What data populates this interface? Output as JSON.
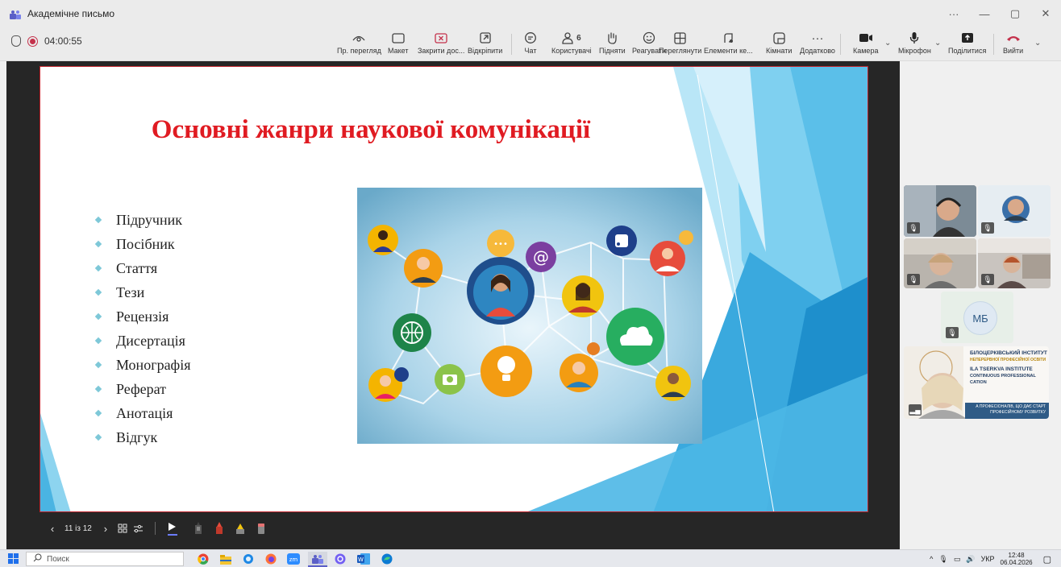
{
  "window": {
    "title": "Академічне письмо",
    "controls": [
      "···",
      "—",
      "▢",
      "✕"
    ]
  },
  "meeting": {
    "timer": "04:00:55",
    "participants_count": "6",
    "toolbar": {
      "preview": "Пр. перегляд",
      "layout": "Макет",
      "close_share": "Закрити дос...",
      "pop_out": "Відкріпити",
      "chat": "Чат",
      "people": "Користувачі",
      "raise": "Підняти",
      "react": "Реагувати",
      "view": "Переглянути",
      "elements": "Елементи ке...",
      "rooms": "Кімнати",
      "more": "Додатково",
      "camera": "Камера",
      "mic": "Мікрофон",
      "share": "Поділитися",
      "leave": "Вийти"
    }
  },
  "slide": {
    "title": "Основні жанри наукової комунікації",
    "bullets": [
      "Підручник",
      "Посібник",
      "Стаття",
      "Тези",
      "Рецензія",
      "Дисертація",
      "Монографія",
      "Реферат",
      "Анотація",
      "Відгук"
    ],
    "image_icon": "social-network-illustration"
  },
  "presenter": {
    "page": "11 із 12"
  },
  "participants": {
    "initials": "МБ",
    "institute_banner": {
      "line1": "БІЛОЦЕРКІВСЬКИЙ ІНСТИТУТ",
      "line2": "НЕПЕРЕРВНОЇ ПРОФЕСІЙНОЇ ОСВІТИ",
      "line3": "ILA TSERKVA INSTITUTE",
      "line4": "CONTINUOUS PROFESSIONAL",
      "line5": "CATION",
      "line6": "А ПРОФЕСІОНАЛІВ, ЩО ДАЄ СТАРТ",
      "line7": "ПРОФЕСІЙНОМУ РОЗВИТКУ"
    }
  },
  "taskbar": {
    "search_placeholder": "Поиск",
    "language": "УКР",
    "time": "12:48",
    "date": "06.04.2026"
  },
  "colors": {
    "title_red": "#e01b22",
    "leave_red": "#c4314b",
    "accent_blue": "#2b9fd6"
  }
}
